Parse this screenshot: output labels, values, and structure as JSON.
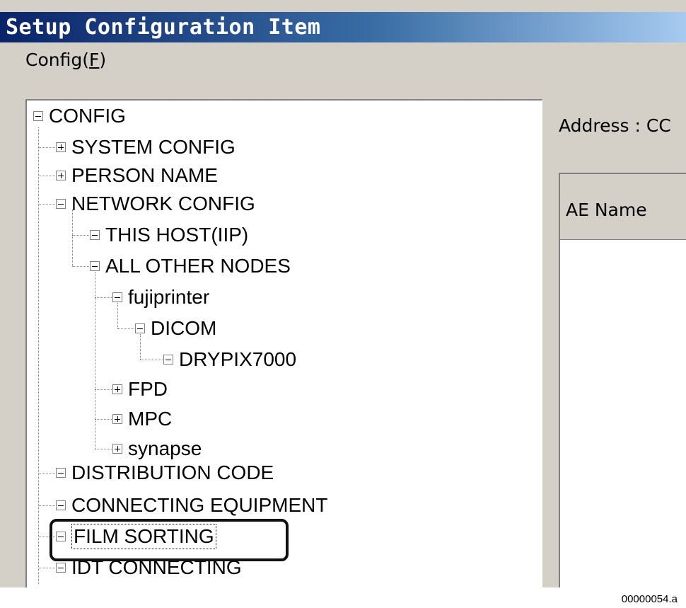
{
  "window": {
    "title": "Setup Configuration Item"
  },
  "menu": {
    "config_label": "Config(",
    "config_accel": "F",
    "config_close": ")"
  },
  "tree": {
    "root": "CONFIG",
    "items": [
      {
        "label": "SYSTEM CONFIG",
        "state": "collapsed"
      },
      {
        "label": "PERSON NAME",
        "state": "collapsed"
      },
      {
        "label": "NETWORK CONFIG",
        "state": "expanded"
      },
      {
        "label": "THIS HOST(IIP)",
        "state": "expanded"
      },
      {
        "label": "ALL OTHER NODES",
        "state": "expanded"
      },
      {
        "label": "fujiprinter",
        "state": "expanded"
      },
      {
        "label": "DICOM",
        "state": "expanded"
      },
      {
        "label": "DRYPIX7000",
        "state": "expanded"
      },
      {
        "label": "FPD",
        "state": "collapsed"
      },
      {
        "label": "MPC",
        "state": "collapsed"
      },
      {
        "label": "synapse",
        "state": "collapsed"
      },
      {
        "label": "DISTRIBUTION CODE",
        "state": "expanded"
      },
      {
        "label": "CONNECTING EQUIPMENT",
        "state": "expanded"
      },
      {
        "label": "FILM SORTING",
        "state": "expanded",
        "selected": true
      },
      {
        "label": "IDT CONNECTING",
        "state": "expanded"
      }
    ]
  },
  "address": {
    "label": "Address :",
    "value": "CC"
  },
  "list": {
    "column_header": "AE Name"
  },
  "caption": "00000054.a"
}
